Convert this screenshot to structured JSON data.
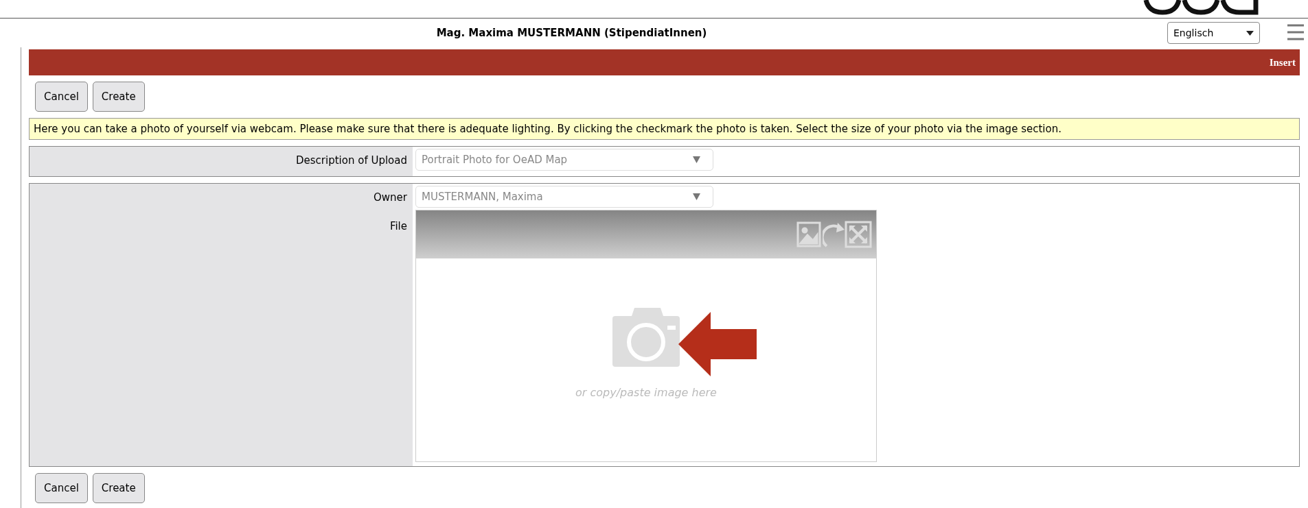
{
  "header": {
    "user_title": "Mag. Maxima MUSTERMANN (StipendiatInnen)",
    "language": "Englisch"
  },
  "section_bar": {
    "title": "Insert"
  },
  "top_buttons": [
    "Cancel",
    "Create"
  ],
  "info": "Here you can take a photo of yourself via webcam. Please make sure that there is adequate lighting. By clicking the checkmark the photo is taken. Select the size of your photo via the image section.",
  "description_field": {
    "label": "Description of Upload",
    "value": "Portrait Photo for OeAD Map"
  },
  "owner_field": {
    "label": "Owner",
    "value": "MUSTERMANN, Maxima"
  },
  "file": {
    "label": "File",
    "drop_hint": "or copy/paste image here"
  },
  "bottom_buttons": [
    "Cancel",
    "Create"
  ]
}
